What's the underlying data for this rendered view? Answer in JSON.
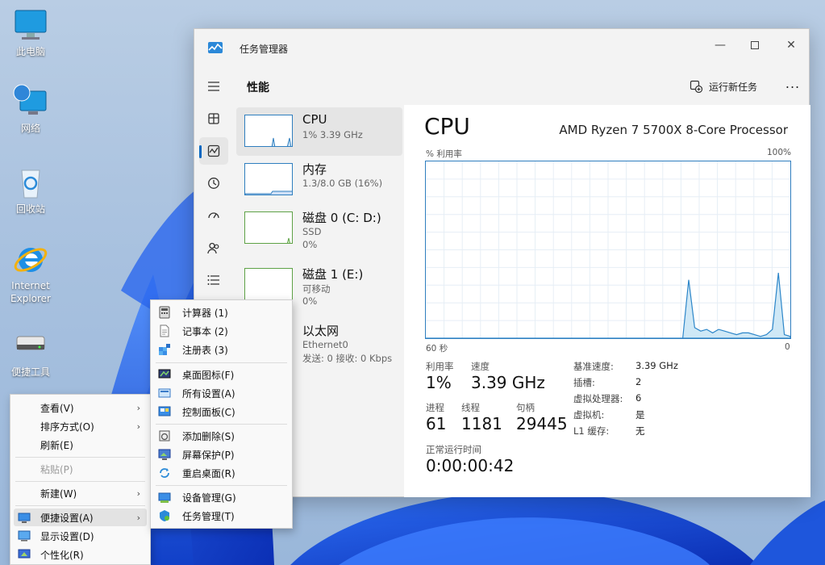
{
  "desktop": {
    "icons": [
      {
        "label": "此电脑"
      },
      {
        "label": "网络"
      },
      {
        "label": "回收站"
      },
      {
        "label": "Internet Explorer"
      },
      {
        "label": "便捷工具"
      }
    ]
  },
  "task_manager": {
    "title": "任务管理器",
    "page_title": "性能",
    "run_task_label": "运行新任务",
    "more_label": "...",
    "nav_icons": [
      "menu-icon",
      "processes-icon",
      "performance-icon",
      "app-history-icon",
      "startup-icon",
      "users-icon",
      "details-icon"
    ],
    "perf_items": [
      {
        "name": "CPU",
        "sub1": "1% 3.39 GHz",
        "sub2": ""
      },
      {
        "name": "内存",
        "sub1": "1.3/8.0 GB (16%)",
        "sub2": ""
      },
      {
        "name": "磁盘 0 (C: D:)",
        "sub1": "SSD",
        "sub2": "0%"
      },
      {
        "name": "磁盘 1 (E:)",
        "sub1": "可移动",
        "sub2": "0%"
      },
      {
        "name": "以太网",
        "sub1": "Ethernet0",
        "sub2": "发送: 0 接收: 0 Kbps"
      }
    ],
    "cpu": {
      "title": "CPU",
      "model": "AMD Ryzen 7 5700X 8-Core Processor",
      "graph_ylabel": "% 利用率",
      "graph_ymax": "100%",
      "graph_xleft": "60 秒",
      "graph_xright": "0",
      "utilization_label": "利用率",
      "utilization": "1%",
      "speed_label": "速度",
      "speed": "3.39 GHz",
      "processes_label": "进程",
      "processes": "61",
      "threads_label": "线程",
      "threads": "1181",
      "handles_label": "句柄",
      "handles": "29445",
      "uptime_label": "正常运行时间",
      "uptime": "0:00:00:42",
      "specs": [
        {
          "k": "基准速度:",
          "v": "3.39 GHz"
        },
        {
          "k": "插槽:",
          "v": "2"
        },
        {
          "k": "虚拟处理器:",
          "v": "6"
        },
        {
          "k": "虚拟机:",
          "v": "是"
        },
        {
          "k": "L1 缓存:",
          "v": "无"
        }
      ],
      "usage_history_percent": [
        0,
        0,
        0,
        0,
        0,
        0,
        0,
        0,
        0,
        0,
        0,
        0,
        0,
        0,
        0,
        0,
        0,
        0,
        0,
        0,
        0,
        0,
        0,
        0,
        0,
        0,
        0,
        0,
        0,
        0,
        0,
        0,
        0,
        0,
        0,
        0,
        0,
        0,
        0,
        0,
        0,
        0,
        0,
        0,
        33,
        6,
        4,
        5,
        3,
        5,
        4,
        3,
        2,
        3,
        3,
        2,
        1,
        2,
        5,
        37,
        2,
        1
      ]
    }
  },
  "desktop_menu": {
    "items": [
      {
        "label": "查看(V)",
        "arrow": "›"
      },
      {
        "label": "排序方式(O)",
        "arrow": "›"
      },
      {
        "label": "刷新(E)"
      },
      {
        "label": "粘贴(P)"
      },
      {
        "label": "新建(W)",
        "arrow": "›"
      },
      {
        "label": "便捷设置(A)",
        "arrow": "›"
      },
      {
        "label": "显示设置(D)"
      },
      {
        "label": "个性化(R)"
      }
    ]
  },
  "sub_menu": {
    "items": [
      {
        "label": "计算器  (1)"
      },
      {
        "label": "记事本  (2)"
      },
      {
        "label": "注册表  (3)"
      },
      {
        "label": "桌面图标(F)"
      },
      {
        "label": "所有设置(A)"
      },
      {
        "label": "控制面板(C)"
      },
      {
        "label": "添加删除(S)"
      },
      {
        "label": "屏幕保护(P)"
      },
      {
        "label": "重启桌面(R)"
      },
      {
        "label": "设备管理(G)"
      },
      {
        "label": "任务管理(T)"
      }
    ]
  }
}
